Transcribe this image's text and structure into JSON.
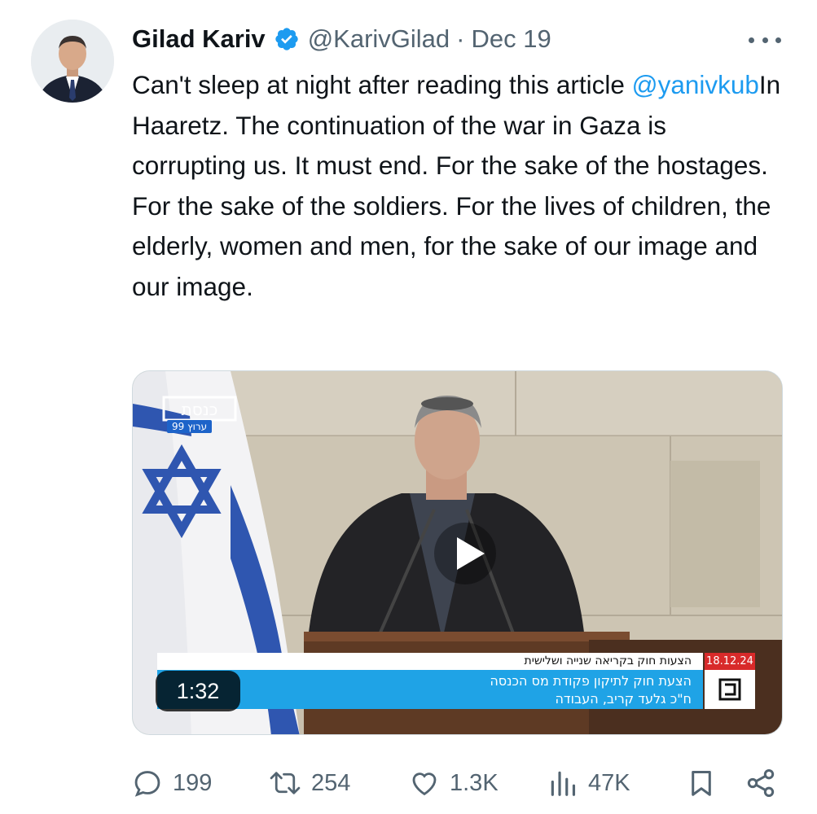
{
  "tweet": {
    "author_name": "Gilad Kariv",
    "handle": "@KarivGilad",
    "separator": "·",
    "date": "Dec 19",
    "text_before": "Can't sleep at night after reading this article ",
    "mention": "@yanivkub",
    "text_after": "In Haaretz. The continuation of the war in Gaza is corrupting us. It must end. For the sake of the hostages. For the sake of the soldiers. For the lives of children, the elderly, women and men, for the sake of our image and our image."
  },
  "media": {
    "duration": "1:32",
    "logo_text": "כנסת",
    "channel_tag": "ערוץ 99",
    "ticker_top": "הצעות חוק בקריאה שנייה ושלישית",
    "ticker_date": "18.12.24",
    "ticker_line1": "הצעת חוק לתיקון פקודת מס הכנסה",
    "ticker_line2": "ח\"כ גלעד קריב, העבודה"
  },
  "actions": {
    "replies": "199",
    "reposts": "254",
    "likes": "1.3K",
    "views": "47K"
  },
  "icons": {
    "verified": "verified-badge-icon",
    "more": "more-options-icon",
    "reply": "reply-icon",
    "repost": "repost-icon",
    "like": "heart-icon",
    "views": "views-chart-icon",
    "bookmark": "bookmark-icon",
    "share": "share-icon",
    "play": "play-icon"
  },
  "colors": {
    "accent": "#1d9bf0",
    "text": "#0f1419",
    "muted": "#536471"
  }
}
